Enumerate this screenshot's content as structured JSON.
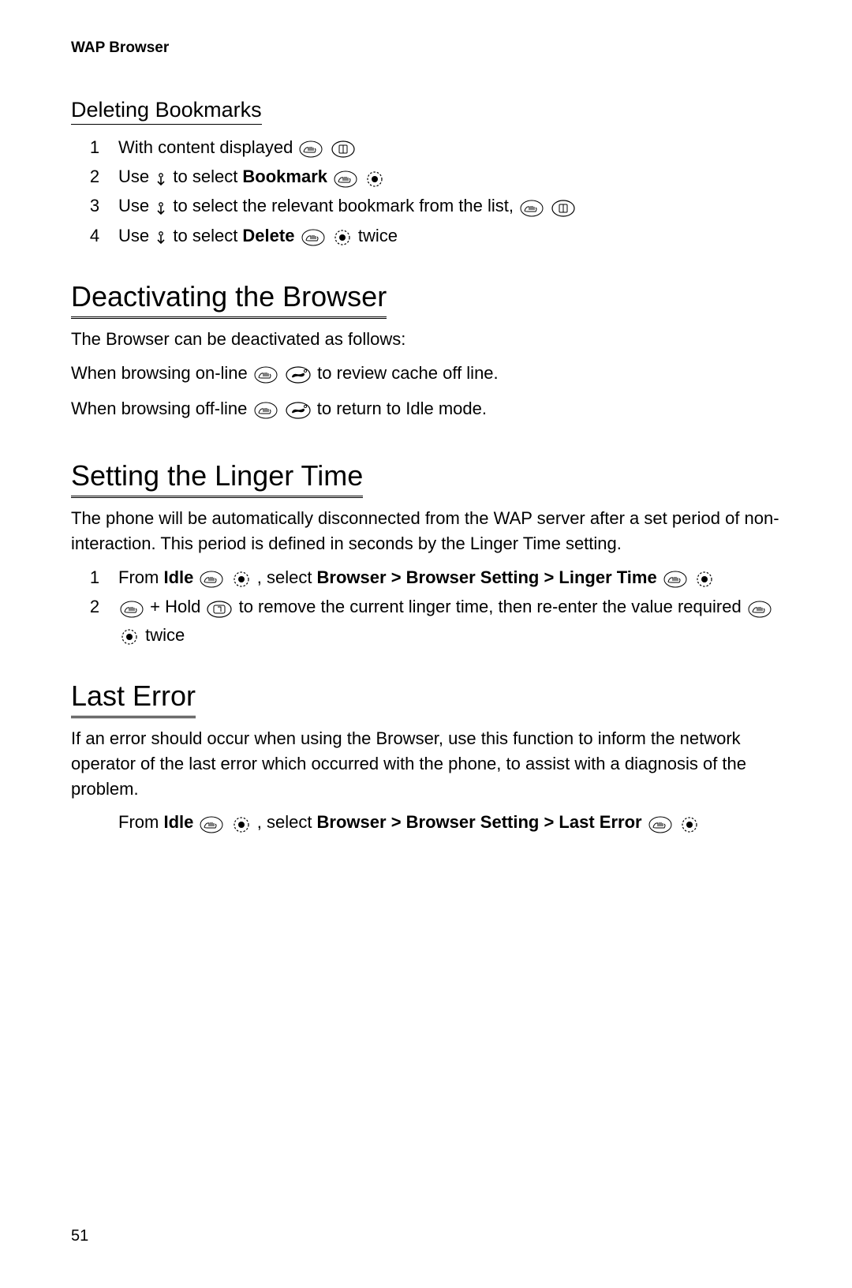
{
  "header": "WAP Browser",
  "page_number": "51",
  "sections": {
    "deleting": {
      "title": "Deleting Bookmarks",
      "steps": [
        {
          "n": "1",
          "pre": "With content displayed ",
          "bold": "",
          "post": "",
          "icons": [
            "hand",
            "softkey"
          ]
        },
        {
          "n": "2",
          "pre": "Use ",
          "nav": true,
          "mid": " to select ",
          "bold": "Bookmark",
          "post": " ",
          "icons": [
            "hand",
            "target"
          ]
        },
        {
          "n": "3",
          "pre": "Use ",
          "nav": true,
          "mid": " to select the relevant bookmark from the list, ",
          "bold": "",
          "post": "",
          "icons": [
            "hand",
            "softkey"
          ]
        },
        {
          "n": "4",
          "pre": "Use ",
          "nav": true,
          "mid": " to select ",
          "bold": "Delete",
          "post": " twice",
          "icons": [
            "hand",
            "target"
          ]
        }
      ]
    },
    "deactivating": {
      "title": "Deactivating the Browser",
      "intro": "The Browser can be deactivated as follows:",
      "line1_pre": "When browsing on-line ",
      "line1_post": " to review cache off line.",
      "line2_pre": "When browsing off-line ",
      "line2_post": " to return to Idle mode."
    },
    "linger": {
      "title": "Setting the Linger Time",
      "intro": "The phone will be automatically disconnected from the WAP server after a set period of non-interaction. This period is defined in seconds by the Linger Time setting.",
      "step1_pre": "From ",
      "step1_idle": "Idle",
      "step1_mid": ", select ",
      "step1_path": "Browser > Browser Setting > Linger Time",
      "step2_pre": " + Hold ",
      "step2_mid": " to remove the current linger time, then re-enter the value required ",
      "step2_post": " twice"
    },
    "lasterror": {
      "title": "Last Error",
      "intro": "If an error should occur when using the Browser, use this function to inform the network operator of the last error which occurred with the phone, to assist with a diagnosis of the problem.",
      "line_pre": "From ",
      "line_idle": "Idle",
      "line_mid": ", select ",
      "line_path": "Browser > Browser Setting > Last Error"
    }
  }
}
